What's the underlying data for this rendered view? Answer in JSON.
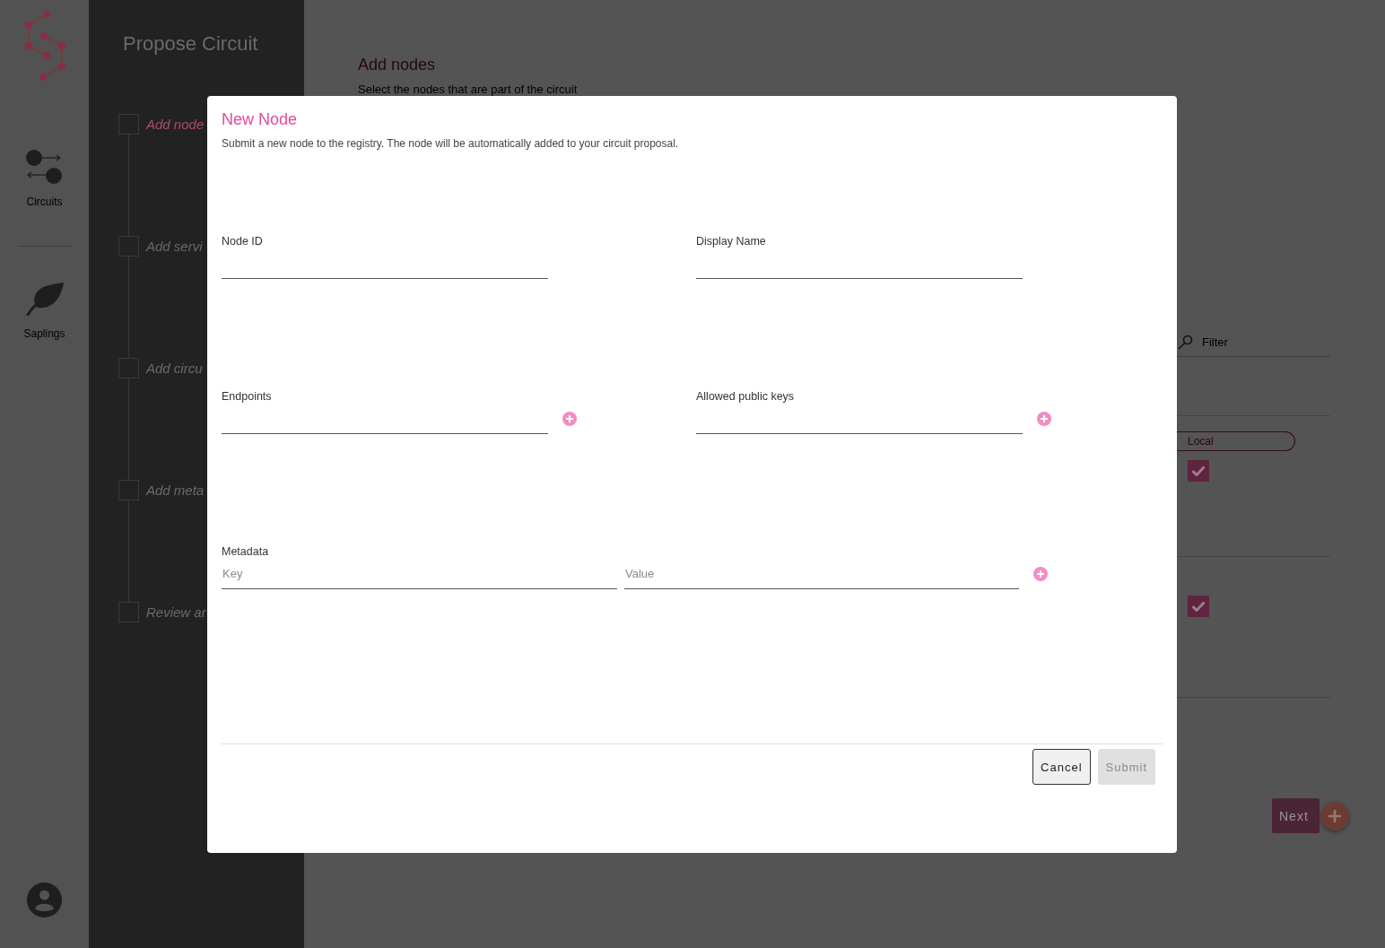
{
  "nav": {
    "items": [
      {
        "label": "Circuits"
      },
      {
        "label": "Saplings"
      }
    ]
  },
  "steps_panel": {
    "title": "Propose Circuit",
    "steps": [
      {
        "label": "Add node",
        "selected": true,
        "checked": false
      },
      {
        "label": "Add servi",
        "selected": false,
        "checked": false
      },
      {
        "label": "Add circu",
        "selected": false,
        "checked": false
      },
      {
        "label": "Add meta",
        "selected": false,
        "checked": false
      },
      {
        "label": "Review ar",
        "selected": false,
        "checked": false
      }
    ]
  },
  "main": {
    "title": "Add nodes",
    "subtitle": "Select the nodes that are part of the circuit",
    "filter": {
      "placeholder": "Filter"
    },
    "rows": [
      {
        "tag": "Local",
        "checked": true
      },
      {
        "checked": true
      }
    ],
    "next_button": {
      "label": "Next"
    }
  },
  "dialog": {
    "title": "New Node",
    "subtitle": "Submit a new node to the registry. The node will be automatically added to your circuit proposal.",
    "fields": [
      {
        "label": "Node ID",
        "kind": "text"
      },
      {
        "label": "Display Name",
        "kind": "text"
      },
      {
        "label": "Endpoints",
        "kind": "list"
      },
      {
        "label": "Allowed public keys",
        "kind": "list"
      }
    ],
    "metadata": {
      "label": "Metadata",
      "inputs": [
        {
          "placeholder": "Key"
        },
        {
          "placeholder": "Value"
        }
      ]
    },
    "buttons": [
      {
        "label": "Cancel",
        "kind": "secondary",
        "disabled": false
      },
      {
        "label": "Submit",
        "kind": "primary",
        "disabled": true
      }
    ]
  }
}
